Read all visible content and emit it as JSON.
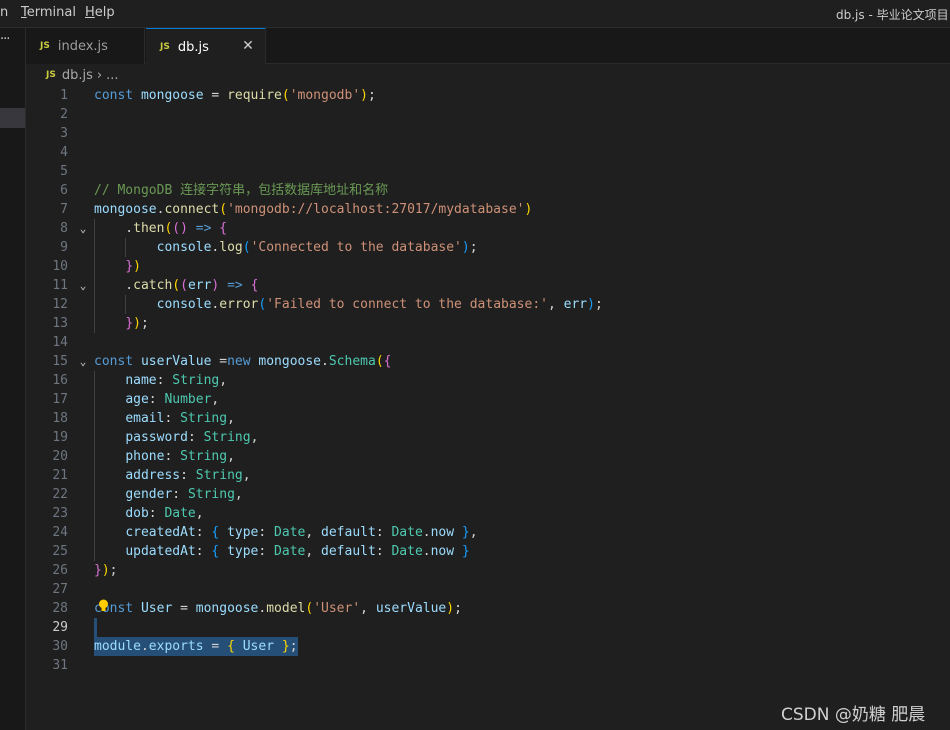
{
  "menubar": {
    "items": [
      {
        "pre": "",
        "mn": "",
        "post": "n"
      },
      {
        "pre": "",
        "mn": "T",
        "post": "erminal"
      },
      {
        "pre": "",
        "mn": "H",
        "post": "elp"
      }
    ],
    "window_title": "db.js - 毕业论文项目"
  },
  "sidebar": {
    "more": "···"
  },
  "tabs": [
    {
      "badge": "JS",
      "label": "index.js",
      "active": false
    },
    {
      "badge": "JS",
      "label": "db.js",
      "active": true,
      "close": "✕"
    }
  ],
  "breadcrumb": {
    "badge": "JS",
    "file": "db.js",
    "sep": "›",
    "rest": "..."
  },
  "editor": {
    "lines": [
      {
        "n": "1",
        "tokens": [
          [
            "kw",
            "const"
          ],
          [
            "pn",
            " "
          ],
          [
            "var",
            "mongoose"
          ],
          [
            "pn",
            " = "
          ],
          [
            "fn",
            "require"
          ],
          [
            "br1",
            "("
          ],
          [
            "str",
            "'mongodb'"
          ],
          [
            "br1",
            ")"
          ],
          [
            "pn",
            ";"
          ]
        ]
      },
      {
        "n": "2",
        "tokens": []
      },
      {
        "n": "3",
        "tokens": []
      },
      {
        "n": "4",
        "tokens": []
      },
      {
        "n": "5",
        "tokens": []
      },
      {
        "n": "6",
        "tokens": [
          [
            "cm",
            "// MongoDB 连接字符串，包括数据库地址和名称"
          ]
        ]
      },
      {
        "n": "7",
        "tokens": [
          [
            "var",
            "mongoose"
          ],
          [
            "pn",
            "."
          ],
          [
            "fn",
            "connect"
          ],
          [
            "br1",
            "("
          ],
          [
            "str",
            "'mongodb://localhost:27017/mydatabase'"
          ],
          [
            "br1",
            ")"
          ]
        ]
      },
      {
        "n": "8",
        "fold": "⌄",
        "tokens": [
          [
            "pn",
            "    ."
          ],
          [
            "fn",
            "then"
          ],
          [
            "br1",
            "("
          ],
          [
            "br2",
            "()"
          ],
          [
            "pn",
            " "
          ],
          [
            "kw",
            "=>"
          ],
          [
            "pn",
            " "
          ],
          [
            "br2",
            "{"
          ]
        ]
      },
      {
        "n": "9",
        "tokens": [
          [
            "pn",
            "        "
          ],
          [
            "var",
            "console"
          ],
          [
            "pn",
            "."
          ],
          [
            "fn",
            "log"
          ],
          [
            "br3",
            "("
          ],
          [
            "str",
            "'Connected to the database'"
          ],
          [
            "br3",
            ")"
          ],
          [
            "pn",
            ";"
          ]
        ]
      },
      {
        "n": "10",
        "tokens": [
          [
            "pn",
            "    "
          ],
          [
            "br2",
            "}"
          ],
          [
            "br1",
            ")"
          ]
        ]
      },
      {
        "n": "11",
        "fold": "⌄",
        "tokens": [
          [
            "pn",
            "    ."
          ],
          [
            "fn",
            "catch"
          ],
          [
            "br1",
            "("
          ],
          [
            "br2",
            "("
          ],
          [
            "var",
            "err"
          ],
          [
            "br2",
            ")"
          ],
          [
            "pn",
            " "
          ],
          [
            "kw",
            "=>"
          ],
          [
            "pn",
            " "
          ],
          [
            "br2",
            "{"
          ]
        ]
      },
      {
        "n": "12",
        "tokens": [
          [
            "pn",
            "        "
          ],
          [
            "var",
            "console"
          ],
          [
            "pn",
            "."
          ],
          [
            "fn",
            "error"
          ],
          [
            "br3",
            "("
          ],
          [
            "str",
            "'Failed to connect to the database:'"
          ],
          [
            "pn",
            ", "
          ],
          [
            "var",
            "err"
          ],
          [
            "br3",
            ")"
          ],
          [
            "pn",
            ";"
          ]
        ]
      },
      {
        "n": "13",
        "tokens": [
          [
            "pn",
            "    "
          ],
          [
            "br2",
            "}"
          ],
          [
            "br1",
            ")"
          ],
          [
            "pn",
            ";"
          ]
        ]
      },
      {
        "n": "14",
        "tokens": []
      },
      {
        "n": "15",
        "fold": "⌄",
        "tokens": [
          [
            "kw",
            "const"
          ],
          [
            "pn",
            " "
          ],
          [
            "var",
            "userValue"
          ],
          [
            "pn",
            " ="
          ],
          [
            "kw",
            "new"
          ],
          [
            "pn",
            " "
          ],
          [
            "var",
            "mongoose"
          ],
          [
            "pn",
            "."
          ],
          [
            "ty",
            "Schema"
          ],
          [
            "br1",
            "("
          ],
          [
            "br2",
            "{"
          ]
        ]
      },
      {
        "n": "16",
        "tokens": [
          [
            "pn",
            "    "
          ],
          [
            "var",
            "name"
          ],
          [
            "pn",
            ": "
          ],
          [
            "ty",
            "String"
          ],
          [
            "pn",
            ","
          ]
        ]
      },
      {
        "n": "17",
        "tokens": [
          [
            "pn",
            "    "
          ],
          [
            "var",
            "age"
          ],
          [
            "pn",
            ": "
          ],
          [
            "ty",
            "Number"
          ],
          [
            "pn",
            ","
          ]
        ]
      },
      {
        "n": "18",
        "tokens": [
          [
            "pn",
            "    "
          ],
          [
            "var",
            "email"
          ],
          [
            "pn",
            ": "
          ],
          [
            "ty",
            "String"
          ],
          [
            "pn",
            ","
          ]
        ]
      },
      {
        "n": "19",
        "tokens": [
          [
            "pn",
            "    "
          ],
          [
            "var",
            "password"
          ],
          [
            "pn",
            ": "
          ],
          [
            "ty",
            "String"
          ],
          [
            "pn",
            ","
          ]
        ]
      },
      {
        "n": "20",
        "tokens": [
          [
            "pn",
            "    "
          ],
          [
            "var",
            "phone"
          ],
          [
            "pn",
            ": "
          ],
          [
            "ty",
            "String"
          ],
          [
            "pn",
            ","
          ]
        ]
      },
      {
        "n": "21",
        "tokens": [
          [
            "pn",
            "    "
          ],
          [
            "var",
            "address"
          ],
          [
            "pn",
            ": "
          ],
          [
            "ty",
            "String"
          ],
          [
            "pn",
            ","
          ]
        ]
      },
      {
        "n": "22",
        "tokens": [
          [
            "pn",
            "    "
          ],
          [
            "var",
            "gender"
          ],
          [
            "pn",
            ": "
          ],
          [
            "ty",
            "String"
          ],
          [
            "pn",
            ","
          ]
        ]
      },
      {
        "n": "23",
        "tokens": [
          [
            "pn",
            "    "
          ],
          [
            "var",
            "dob"
          ],
          [
            "pn",
            ": "
          ],
          [
            "ty",
            "Date"
          ],
          [
            "pn",
            ","
          ]
        ]
      },
      {
        "n": "24",
        "tokens": [
          [
            "pn",
            "    "
          ],
          [
            "var",
            "createdAt"
          ],
          [
            "pn",
            ": "
          ],
          [
            "br3",
            "{"
          ],
          [
            "pn",
            " "
          ],
          [
            "var",
            "type"
          ],
          [
            "pn",
            ": "
          ],
          [
            "ty",
            "Date"
          ],
          [
            "pn",
            ", "
          ],
          [
            "var",
            "default"
          ],
          [
            "pn",
            ": "
          ],
          [
            "ty",
            "Date"
          ],
          [
            "pn",
            "."
          ],
          [
            "var",
            "now"
          ],
          [
            "pn",
            " "
          ],
          [
            "br3",
            "}"
          ],
          [
            "pn",
            ","
          ]
        ]
      },
      {
        "n": "25",
        "tokens": [
          [
            "pn",
            "    "
          ],
          [
            "var",
            "updatedAt"
          ],
          [
            "pn",
            ": "
          ],
          [
            "br3",
            "{"
          ],
          [
            "pn",
            " "
          ],
          [
            "var",
            "type"
          ],
          [
            "pn",
            ": "
          ],
          [
            "ty",
            "Date"
          ],
          [
            "pn",
            ", "
          ],
          [
            "var",
            "default"
          ],
          [
            "pn",
            ": "
          ],
          [
            "ty",
            "Date"
          ],
          [
            "pn",
            "."
          ],
          [
            "var",
            "now"
          ],
          [
            "pn",
            " "
          ],
          [
            "br3",
            "}"
          ]
        ]
      },
      {
        "n": "26",
        "tokens": [
          [
            "br2",
            "}"
          ],
          [
            "br1",
            ")"
          ],
          [
            "pn",
            ";"
          ]
        ]
      },
      {
        "n": "27",
        "tokens": []
      },
      {
        "n": "28",
        "tokens": [
          [
            "kw",
            "const"
          ],
          [
            "pn",
            " "
          ],
          [
            "var",
            "User"
          ],
          [
            "pn",
            " = "
          ],
          [
            "var",
            "mongoose"
          ],
          [
            "pn",
            "."
          ],
          [
            "fn",
            "model"
          ],
          [
            "br1",
            "("
          ],
          [
            "str",
            "'User'"
          ],
          [
            "pn",
            ", "
          ],
          [
            "var",
            "userValue"
          ],
          [
            "br1",
            ")"
          ],
          [
            "pn",
            ";"
          ]
        ]
      },
      {
        "n": "29",
        "current": true,
        "tokens": []
      },
      {
        "n": "30",
        "tokens": [
          [
            "var",
            "module"
          ],
          [
            "pn",
            "."
          ],
          [
            "var",
            "exports"
          ],
          [
            "pn",
            " = "
          ],
          [
            "br1",
            "{"
          ],
          [
            "pn",
            " "
          ],
          [
            "var",
            "User"
          ],
          [
            "pn",
            " "
          ],
          [
            "br1",
            "}"
          ],
          [
            "pn",
            ";"
          ]
        ]
      },
      {
        "n": "31",
        "tokens": []
      }
    ]
  },
  "watermark": "CSDN @奶糖 肥晨",
  "colors": {
    "accent": "#0078d4",
    "selection": "#264f78",
    "editor_bg": "#1f1f1f"
  }
}
